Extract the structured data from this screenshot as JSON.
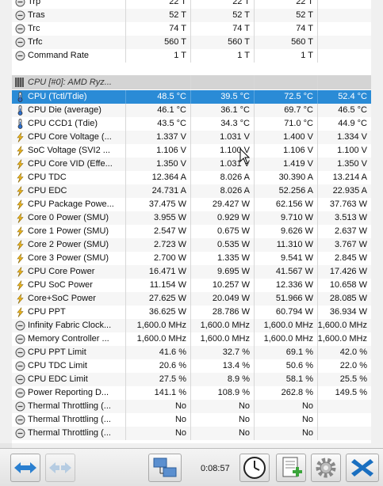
{
  "rows_top": [
    {
      "label": "Trp",
      "icon": "clock-icon",
      "v": [
        "22 T",
        "22 T",
        "22 T",
        ""
      ]
    },
    {
      "label": "Tras",
      "icon": "clock-icon",
      "v": [
        "52 T",
        "52 T",
        "52 T",
        ""
      ]
    },
    {
      "label": "Trc",
      "icon": "clock-icon",
      "v": [
        "74 T",
        "74 T",
        "74 T",
        ""
      ]
    },
    {
      "label": "Trfc",
      "icon": "clock-icon",
      "v": [
        "560 T",
        "560 T",
        "560 T",
        ""
      ]
    },
    {
      "label": "Command Rate",
      "icon": "clock-icon",
      "v": [
        "1 T",
        "1 T",
        "1 T",
        ""
      ]
    }
  ],
  "group": {
    "label": "CPU [#0]: AMD Ryz..."
  },
  "rows": [
    {
      "label": "CPU (Tctl/Tdie)",
      "icon": "thermometer-icon",
      "v": [
        "48.5 °C",
        "39.5 °C",
        "72.5 °C",
        "52.4 °C"
      ],
      "selected": true
    },
    {
      "label": "CPU Die (average)",
      "icon": "thermometer-icon",
      "v": [
        "46.1 °C",
        "36.1 °C",
        "69.7 °C",
        "46.5 °C"
      ]
    },
    {
      "label": "CPU CCD1 (Tdie)",
      "icon": "thermometer-icon",
      "v": [
        "43.5 °C",
        "34.3 °C",
        "71.0 °C",
        "44.9 °C"
      ]
    },
    {
      "label": "CPU Core Voltage (...",
      "icon": "lightning-icon",
      "v": [
        "1.337 V",
        "1.031 V",
        "1.400 V",
        "1.334 V"
      ]
    },
    {
      "label": "SoC Voltage (SVI2 ...",
      "icon": "lightning-icon",
      "v": [
        "1.106 V",
        "1.100 V",
        "1.106 V",
        "1.100 V"
      ]
    },
    {
      "label": "CPU Core VID (Effe...",
      "icon": "lightning-icon",
      "v": [
        "1.350 V",
        "1.031 V",
        "1.419 V",
        "1.350 V"
      ]
    },
    {
      "label": "CPU TDC",
      "icon": "lightning-icon",
      "v": [
        "12.364 A",
        "8.026 A",
        "30.390 A",
        "13.214 A"
      ]
    },
    {
      "label": "CPU EDC",
      "icon": "lightning-icon",
      "v": [
        "24.731 A",
        "8.026 A",
        "52.256 A",
        "22.935 A"
      ]
    },
    {
      "label": "CPU Package Powe...",
      "icon": "lightning-icon",
      "v": [
        "37.475 W",
        "29.427 W",
        "62.156 W",
        "37.763 W"
      ]
    },
    {
      "label": "Core 0 Power (SMU)",
      "icon": "lightning-icon",
      "v": [
        "3.955 W",
        "0.929 W",
        "9.710 W",
        "3.513 W"
      ]
    },
    {
      "label": "Core 1 Power (SMU)",
      "icon": "lightning-icon",
      "v": [
        "2.547 W",
        "0.675 W",
        "9.626 W",
        "2.637 W"
      ]
    },
    {
      "label": "Core 2 Power (SMU)",
      "icon": "lightning-icon",
      "v": [
        "2.723 W",
        "0.535 W",
        "11.310 W",
        "3.767 W"
      ]
    },
    {
      "label": "Core 3 Power (SMU)",
      "icon": "lightning-icon",
      "v": [
        "2.700 W",
        "1.335 W",
        "9.541 W",
        "2.845 W"
      ]
    },
    {
      "label": "CPU Core Power",
      "icon": "lightning-icon",
      "v": [
        "16.471 W",
        "9.695 W",
        "41.567 W",
        "17.426 W"
      ]
    },
    {
      "label": "CPU SoC Power",
      "icon": "lightning-icon",
      "v": [
        "11.154 W",
        "10.257 W",
        "12.336 W",
        "10.658 W"
      ]
    },
    {
      "label": "Core+SoC Power",
      "icon": "lightning-icon",
      "v": [
        "27.625 W",
        "20.049 W",
        "51.966 W",
        "28.085 W"
      ]
    },
    {
      "label": "CPU PPT",
      "icon": "lightning-icon",
      "v": [
        "36.625 W",
        "28.786 W",
        "60.794 W",
        "36.934 W"
      ]
    },
    {
      "label": "Infinity Fabric Clock...",
      "icon": "clock-icon",
      "v": [
        "1,600.0 MHz",
        "1,600.0 MHz",
        "1,600.0 MHz",
        "1,600.0 MHz"
      ]
    },
    {
      "label": "Memory Controller ...",
      "icon": "clock-icon",
      "v": [
        "1,600.0 MHz",
        "1,600.0 MHz",
        "1,600.0 MHz",
        "1,600.0 MHz"
      ]
    },
    {
      "label": "CPU PPT Limit",
      "icon": "clock-icon",
      "v": [
        "41.6 %",
        "32.7 %",
        "69.1 %",
        "42.0 %"
      ]
    },
    {
      "label": "CPU TDC Limit",
      "icon": "clock-icon",
      "v": [
        "20.6 %",
        "13.4 %",
        "50.6 %",
        "22.0 %"
      ]
    },
    {
      "label": "CPU EDC Limit",
      "icon": "clock-icon",
      "v": [
        "27.5 %",
        "8.9 %",
        "58.1 %",
        "25.5 %"
      ]
    },
    {
      "label": "Power Reporting D...",
      "icon": "clock-icon",
      "v": [
        "141.1 %",
        "108.9 %",
        "262.8 %",
        "149.5 %"
      ]
    },
    {
      "label": "Thermal Throttling (...",
      "icon": "clock-icon",
      "v": [
        "No",
        "No",
        "No",
        ""
      ]
    },
    {
      "label": "Thermal Throttling (...",
      "icon": "clock-icon",
      "v": [
        "No",
        "No",
        "No",
        ""
      ]
    },
    {
      "label": "Thermal Throttling (...",
      "icon": "clock-icon",
      "v": [
        "No",
        "No",
        "No",
        ""
      ]
    }
  ],
  "toolbar": {
    "timer": "0:08:57"
  },
  "colors": {
    "selected": "#2a8bd6",
    "accent": "#1e90e0",
    "close": "#1a6fc0"
  }
}
